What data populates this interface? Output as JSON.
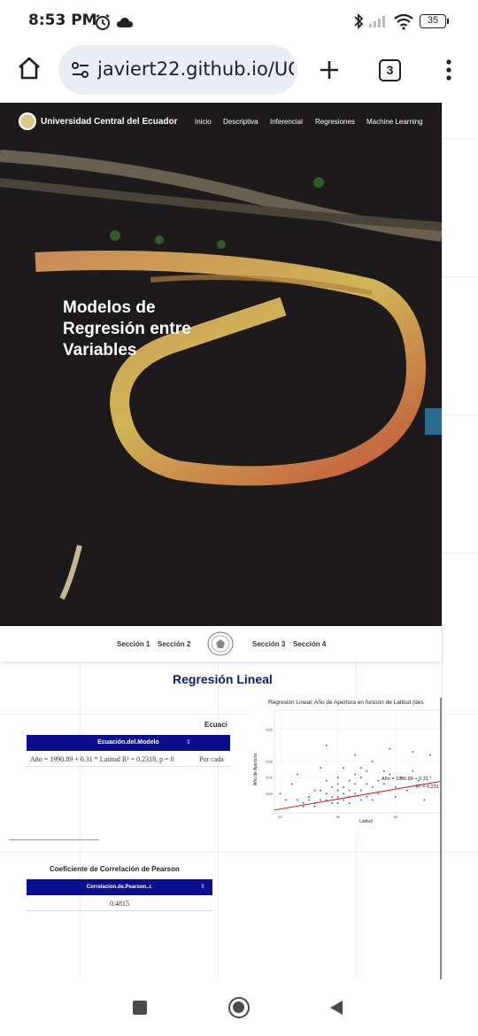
{
  "status": {
    "time": "8:53 PM",
    "battery": "35"
  },
  "browser": {
    "url": "javiert22.github.io/UC",
    "tab_count": "3"
  },
  "nav": {
    "brand": "Universidad Central del Ecuador",
    "items": [
      "Inicio",
      "Descriptiva",
      "Inferencial",
      "Regresiones",
      "Machine Learning"
    ]
  },
  "hero": {
    "title": "Modelos de Regresión entre Variables"
  },
  "sections": [
    "Sección 1",
    "Sección 2",
    "Sección 3",
    "Sección 4"
  ],
  "regression": {
    "heading": "Regresión Lineal",
    "equation_caption": "Ecuaci",
    "table_header": "Ecuación.del.Modelo",
    "table_value": "Año = 1990.89 + 0.31 * Latitud R² = 0.2318, p = 0",
    "table_value2": "Por cada",
    "chart_title": "Regresión Lineal: Año de Apertura en función de Latitud (des",
    "chart_xlabel": "Latitud",
    "chart_ylabel": "Año de Apertura",
    "chart_annotation1": "Año = 1990.89 + 0.31 *",
    "chart_annotation2": "R² = 0.231"
  },
  "pearson": {
    "heading": "Coeficiente de Correlación de Pearson",
    "table_header": "Correlacion.de.Pearson..r.",
    "value": "0.4815"
  },
  "chart_data": {
    "type": "scatter",
    "title": "Regresión Lineal: Año de Apertura en función de Latitud (des",
    "xlabel": "Latitud",
    "ylabel": "Año de Apertura",
    "x_ticks": [
      "30",
      "40",
      "50"
    ],
    "y_ticks": [
      "2005",
      "2010",
      "2015",
      "2025"
    ],
    "xlim": [
      29,
      58
    ],
    "ylim": [
      1999,
      2031
    ],
    "points": [
      [
        30,
        2005
      ],
      [
        31,
        2003
      ],
      [
        32,
        2008
      ],
      [
        33,
        2011
      ],
      [
        33,
        2003
      ],
      [
        34,
        2001
      ],
      [
        34,
        2002
      ],
      [
        35,
        2004
      ],
      [
        35,
        2003
      ],
      [
        36,
        2006
      ],
      [
        36,
        2001
      ],
      [
        36,
        2002
      ],
      [
        37,
        2013
      ],
      [
        37,
        2006
      ],
      [
        37,
        2003
      ],
      [
        38,
        2020
      ],
      [
        38,
        2009
      ],
      [
        38,
        2005
      ],
      [
        38,
        2003
      ],
      [
        39,
        2007
      ],
      [
        39,
        2004
      ],
      [
        39,
        2002
      ],
      [
        40,
        2010
      ],
      [
        40,
        2008
      ],
      [
        40,
        2006
      ],
      [
        40,
        2004
      ],
      [
        40,
        2002
      ],
      [
        41,
        2013
      ],
      [
        41,
        2007
      ],
      [
        41,
        2005
      ],
      [
        41,
        2003
      ],
      [
        42,
        2009
      ],
      [
        42,
        2006
      ],
      [
        42,
        2004
      ],
      [
        42,
        2002
      ],
      [
        43,
        2017
      ],
      [
        43,
        2011
      ],
      [
        43,
        2008
      ],
      [
        43,
        2005
      ],
      [
        44,
        2013
      ],
      [
        44,
        2010
      ],
      [
        44,
        2006
      ],
      [
        44,
        2003
      ],
      [
        45,
        2012
      ],
      [
        45,
        2008
      ],
      [
        45,
        2004
      ],
      [
        46,
        2015
      ],
      [
        46,
        2007
      ],
      [
        46,
        2003
      ],
      [
        47,
        2009
      ],
      [
        47,
        2005
      ],
      [
        48,
        2012
      ],
      [
        48,
        2008
      ],
      [
        49,
        2019
      ],
      [
        49,
        2011
      ],
      [
        50,
        2007
      ],
      [
        50,
        2004
      ],
      [
        51,
        2010
      ],
      [
        52,
        2006
      ],
      [
        53,
        2018
      ],
      [
        53,
        2012
      ],
      [
        54,
        2009
      ],
      [
        55,
        2003
      ],
      [
        56,
        2017
      ]
    ],
    "fit": {
      "intercept": 1990.89,
      "slope": 0.31
    },
    "colors": {
      "points": "#3a4aa0",
      "line": "#d01010"
    }
  }
}
